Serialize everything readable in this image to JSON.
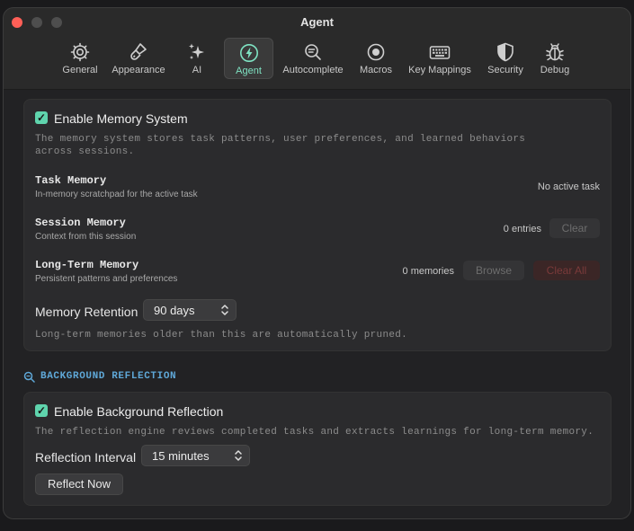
{
  "window": {
    "title": "Agent"
  },
  "tabs": [
    {
      "id": "general",
      "label": "General",
      "icon": "gear-icon"
    },
    {
      "id": "appearance",
      "label": "Appearance",
      "icon": "paintbrush-icon"
    },
    {
      "id": "ai",
      "label": "AI",
      "icon": "sparkles-icon"
    },
    {
      "id": "agent",
      "label": "Agent",
      "icon": "bolt-icon",
      "active": true
    },
    {
      "id": "autocomplete",
      "label": "Autocomplete",
      "icon": "search-lines-icon"
    },
    {
      "id": "macros",
      "label": "Macros",
      "icon": "record-icon"
    },
    {
      "id": "key_mappings",
      "label": "Key Mappings",
      "icon": "keyboard-icon"
    },
    {
      "id": "security",
      "label": "Security",
      "icon": "shield-icon"
    },
    {
      "id": "debug",
      "label": "Debug",
      "icon": "bug-icon"
    }
  ],
  "memory": {
    "enable_label": "Enable Memory System",
    "enabled": true,
    "description": "The memory system stores task patterns, user preferences, and learned behaviors across sessions.",
    "task": {
      "title": "Task Memory",
      "subtitle": "In-memory scratchpad for the active task",
      "status": "No active task"
    },
    "session": {
      "title": "Session Memory",
      "subtitle": "Context from this session",
      "count": "0 entries",
      "clear_label": "Clear"
    },
    "long_term": {
      "title": "Long-Term Memory",
      "subtitle": "Persistent patterns and preferences",
      "count": "0 memories",
      "browse_label": "Browse",
      "clear_all_label": "Clear All"
    },
    "retention": {
      "label": "Memory Retention",
      "value": "90 days",
      "note": "Long-term memories older than this are automatically pruned."
    }
  },
  "reflection": {
    "section_title": "BACKGROUND REFLECTION",
    "enable_label": "Enable Background Reflection",
    "enabled": true,
    "description": "The reflection engine reviews completed tasks and extracts learnings for long-term memory.",
    "interval": {
      "label": "Reflection Interval",
      "value": "15 minutes"
    },
    "reflect_now_label": "Reflect Now"
  },
  "colors": {
    "accent": "#5fd4ad",
    "section_accent": "#5fa8d8",
    "active_tab": "#7fe3c3",
    "danger": "#7a3a3a"
  }
}
